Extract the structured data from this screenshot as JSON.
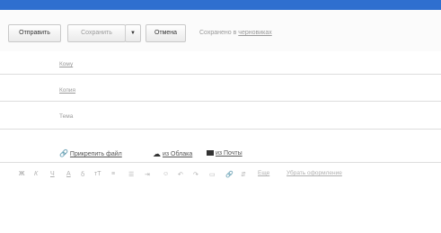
{
  "toolbar": {
    "send_label": "Отправить",
    "save_label": "Сохранить",
    "dropdown_icon": "caret-down",
    "cancel_label": "Отмена",
    "saved_prefix": "Сохранено в ",
    "saved_link": "черновиках"
  },
  "fields": {
    "to_label": "Кому",
    "cc_label": "Копия",
    "subject_label": "Тема"
  },
  "attachments": {
    "attach_file": "Прикрепить файл",
    "from_cloud": "из Облака",
    "from_mail": "из Почты"
  },
  "format": {
    "bold": "Ж",
    "italic": "К",
    "underline": "Ч",
    "text_color": "А",
    "bg_color": "ẟ",
    "font_size": "тТ",
    "align": "≡",
    "lists": "☰",
    "indent": "⇥",
    "emoji": "☺",
    "undo": "↶",
    "redo": "↷",
    "template": "▭",
    "link": "🔗",
    "clear": "⇵",
    "more_label": "Еще",
    "plain_text_link": "Убрать оформление"
  }
}
